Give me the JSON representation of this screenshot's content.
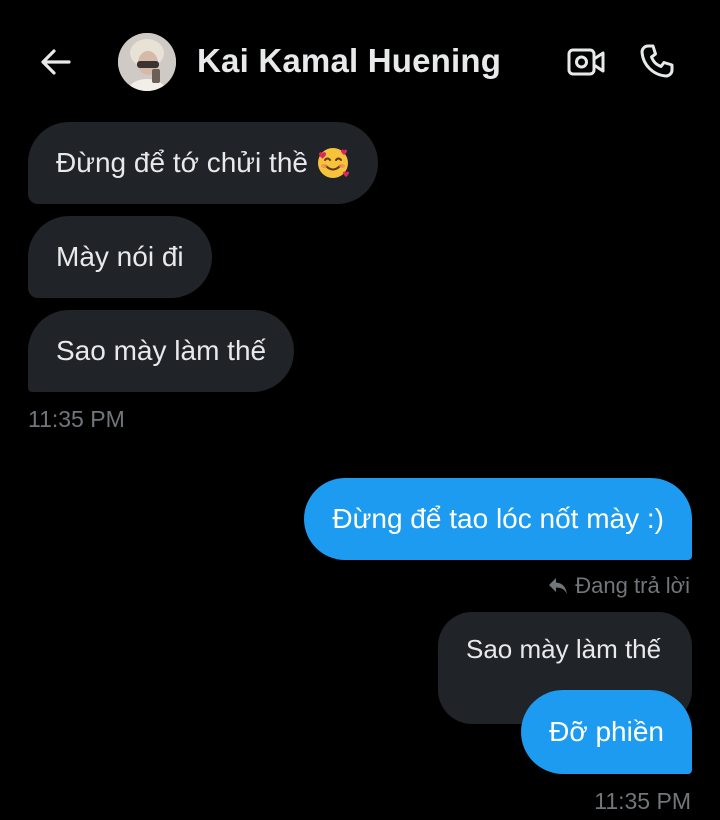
{
  "header": {
    "contact_name": "Kai Kamal Huening"
  },
  "messages": {
    "incoming": [
      {
        "text": "Đừng để tớ chửi thề",
        "emoji": "smiling-face-with-hearts"
      },
      {
        "text": "Mày nói đi"
      },
      {
        "text": "Sao mày làm thế"
      }
    ],
    "incoming_time": "11:35 PM",
    "outgoing": [
      {
        "text": "Đừng để tao lóc nốt mày :)"
      },
      {
        "text": "Đỡ phiền"
      }
    ],
    "reply": {
      "label": "Đang trả lời",
      "quoted_text": "Sao mày làm thế"
    },
    "outgoing_time": "11:35 PM"
  },
  "colors": {
    "background": "#000000",
    "incoming_bubble": "#202327",
    "outgoing_bubble": "#1d9bf0",
    "secondary_text": "#71767b"
  },
  "icons": [
    "back-arrow-icon",
    "video-camera-icon",
    "phone-icon",
    "reply-icon"
  ]
}
